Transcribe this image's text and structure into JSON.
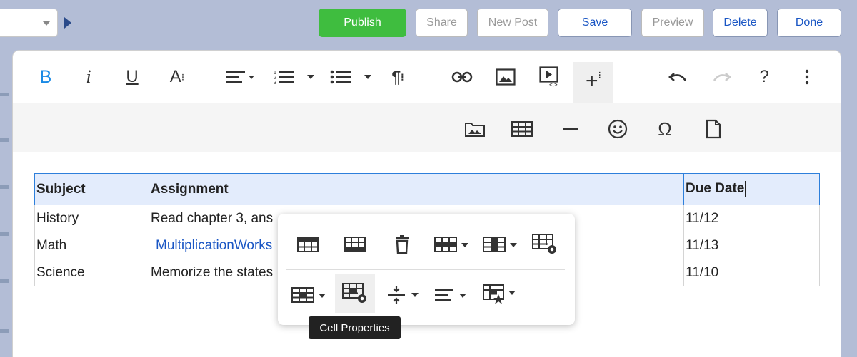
{
  "topbar": {
    "buttons": {
      "publish": "Publish",
      "share": "Share",
      "new_post": "New Post",
      "save": "Save",
      "preview": "Preview",
      "delete": "Delete",
      "done": "Done"
    }
  },
  "toolbar": {
    "bold_glyph": "B",
    "italic_glyph": "i",
    "underline_glyph": "U",
    "font_glyph": "A",
    "paragraph_glyph": "¶",
    "help_glyph": "?",
    "accent": "#1a8ae5"
  },
  "table": {
    "headers": [
      "Subject",
      "Assignment",
      "Due Date"
    ],
    "rows": [
      [
        "History",
        "Read chapter 3, ans",
        "11/12"
      ],
      [
        "Math",
        "MultiplicationWorks",
        "11/13"
      ],
      [
        "Science",
        "Memorize the states",
        "11/10"
      ]
    ]
  },
  "popup": {
    "tooltip": "Cell Properties"
  },
  "colors": {
    "publish": "#3fbd3f",
    "header_bg": "#e3ecfc",
    "header_border": "#2d7fdb",
    "link": "#1a56c4"
  }
}
